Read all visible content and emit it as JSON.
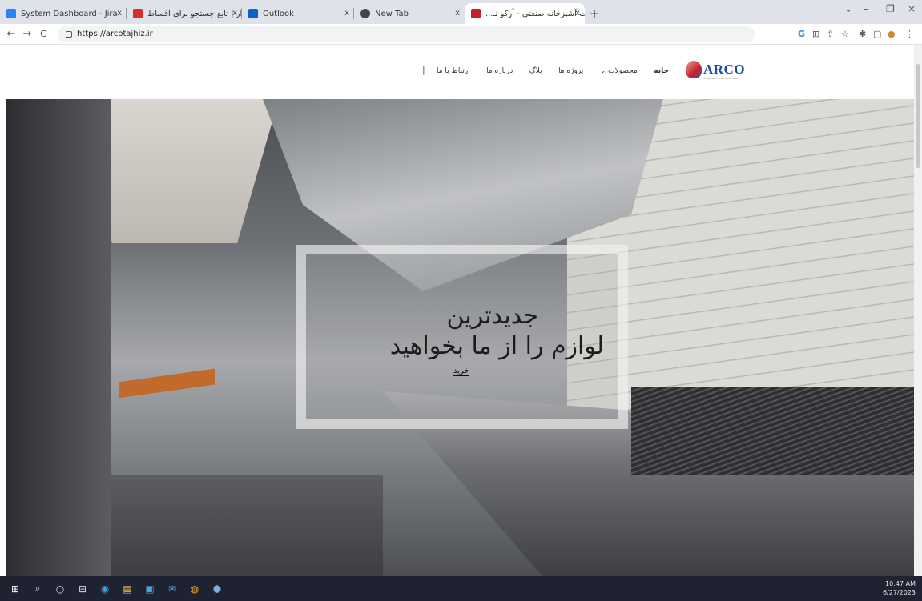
{
  "browser": {
    "tabs": [
      {
        "title": "System Dashboard - Jira",
        "favicon_color": "#2684ff"
      },
      {
        "title": "دیوار | تابع جستجو برای اقساط",
        "favicon_color": "#d32f2f"
      },
      {
        "title": "Outlook",
        "favicon_color": "#0a64c8"
      },
      {
        "title": "New Tab",
        "favicon_color": "#444444"
      },
      {
        "title": "تجهیزات آشپزخانه صنعتی - آرکو تـ...",
        "favicon_color": "#c8202a"
      }
    ],
    "tab_close": "x",
    "new_tab": "+",
    "window_controls": {
      "chevron": "⌄",
      "minimize": "–",
      "maximize": "❐",
      "close": "×"
    },
    "nav": {
      "back": "←",
      "forward": "→",
      "reload": "C"
    },
    "url": "https://arcotajhiz.ir",
    "toolbar_icons": [
      "G",
      "⊞",
      "⇪",
      "☆",
      "✱",
      "▢",
      "●",
      "⋮"
    ]
  },
  "site": {
    "logo_text": "ARCO",
    "logo_subtext": "Industrial Kitchen Equipment",
    "nav_items": [
      {
        "label": "خانه"
      },
      {
        "label": "محصولات ⌄"
      },
      {
        "label": "پروژه ها"
      },
      {
        "label": "بلاگ"
      },
      {
        "label": "درباره ما"
      },
      {
        "label": "ارتباط با ما"
      }
    ],
    "nav_separator": "|",
    "hero": {
      "headline_line1": "جدیدترین",
      "headline_line2": "لوازم را از ما بخواهید",
      "cta_label": "خرید"
    }
  },
  "taskbar": {
    "icons": [
      "⊞",
      "⌕",
      "○",
      "⊟",
      "◉",
      "▤",
      "▣",
      "✉",
      "◍",
      "⬢"
    ],
    "time": "10:47 AM",
    "date": "6/27/2023"
  }
}
